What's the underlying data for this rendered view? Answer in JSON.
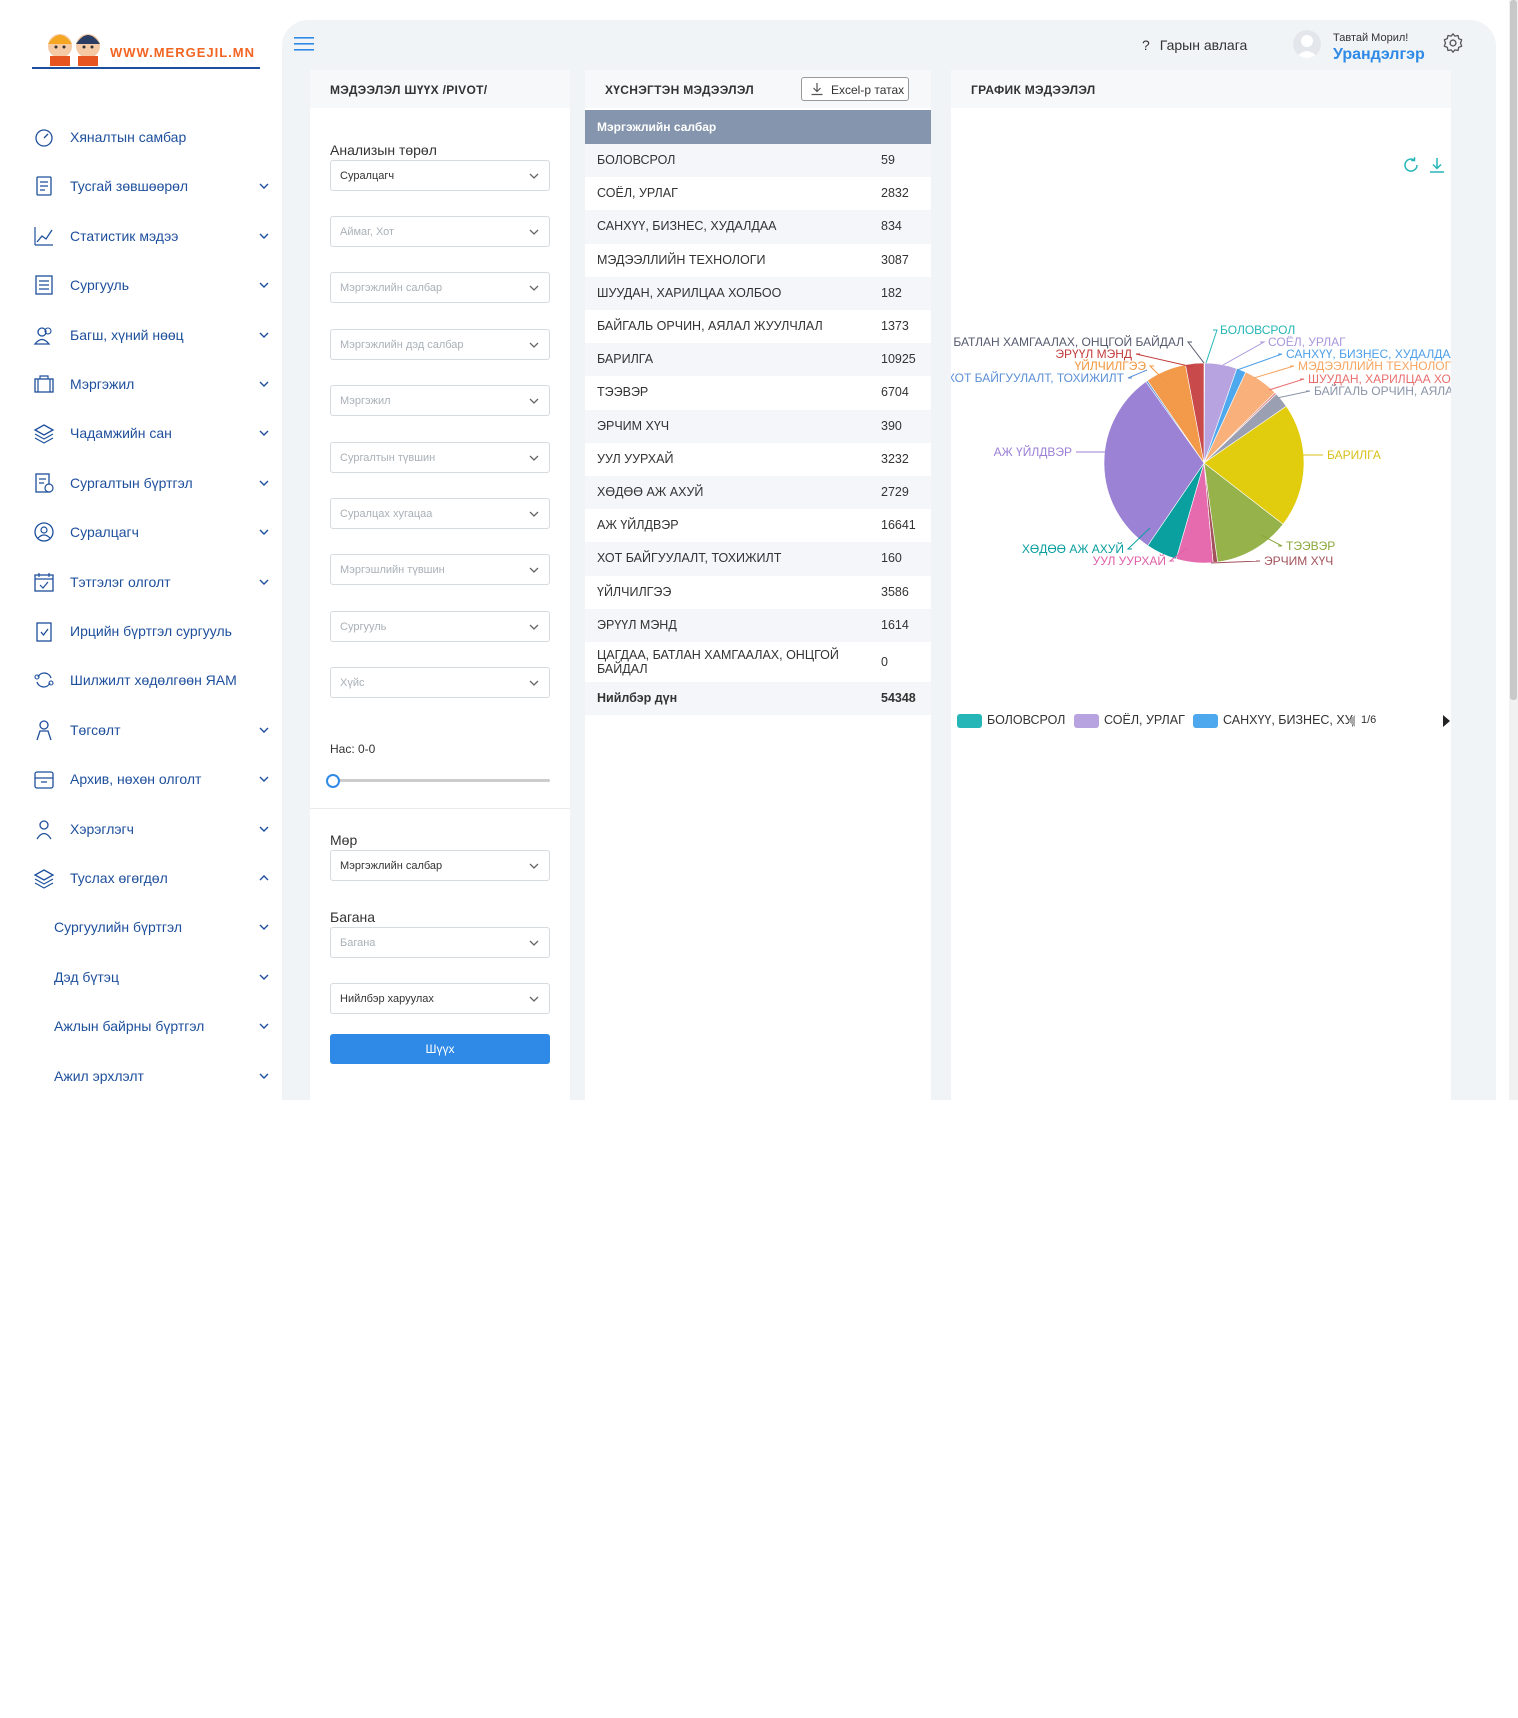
{
  "brand": {
    "site": "WWW.MERGEJIL.MN"
  },
  "sidebar": {
    "items": [
      {
        "label": "Хяналтын самбар",
        "icon": "dashboard-icon",
        "chevron": ""
      },
      {
        "label": "Тусгай зөвшөөрөл",
        "icon": "document-icon",
        "chevron": "down"
      },
      {
        "label": "Статистик мэдээ",
        "icon": "line-chart-icon",
        "chevron": "down"
      },
      {
        "label": "Сургууль",
        "icon": "list-icon",
        "chevron": "down"
      },
      {
        "label": "Багш, хүний нөөц",
        "icon": "users-icon",
        "chevron": "down"
      },
      {
        "label": "Мэргэжил",
        "icon": "briefcase-icon",
        "chevron": "down"
      },
      {
        "label": "Чадамжийн сан",
        "icon": "layers-icon",
        "chevron": "down"
      },
      {
        "label": "Сургалтын бүртгэл",
        "icon": "register-icon",
        "chevron": "down"
      },
      {
        "label": "Суралцагч",
        "icon": "student-icon",
        "chevron": "down"
      },
      {
        "label": "Тэтгэлэг олголт",
        "icon": "calendar-check-icon",
        "chevron": "down"
      },
      {
        "label": "Ирцийн бүртгэл сургууль",
        "icon": "clipboard-check-icon",
        "chevron": ""
      },
      {
        "label": "Шилжилт хөдөлгөөн ЯАМ",
        "icon": "transfer-icon",
        "chevron": ""
      },
      {
        "label": "Төгсөлт",
        "icon": "graduate-icon",
        "chevron": "down"
      },
      {
        "label": "Архив, нөхөн олголт",
        "icon": "archive-icon",
        "chevron": "down"
      },
      {
        "label": "Хэрэглэгч",
        "icon": "user-settings-icon",
        "chevron": "down"
      },
      {
        "label": "Туслах өгөгдөл",
        "icon": "stack-icon",
        "chevron": "up"
      }
    ],
    "subitems": [
      {
        "label": "Сургуулийн бүртгэл"
      },
      {
        "label": "Дэд бүтэц"
      },
      {
        "label": "Ажлын байрны бүртгэл"
      },
      {
        "label": "Ажил эрхлэлт"
      }
    ]
  },
  "topbar": {
    "help_label": "Гарын авлага",
    "welcome": "Тавтай Морил!",
    "username": "Урандэлгэр"
  },
  "filter_panel": {
    "title": "МЭДЭЭЛЭЛ ШҮҮХ /PIVOT/",
    "analysis_label": "Анализын төрөл",
    "analysis_value": "Суралцагч",
    "placeholders": [
      "Аймаг, Хот",
      "Мэргэжлийн салбар",
      "Мэргэжлийн дэд салбар",
      "Мэргэжил",
      "Сургалтын түвшин",
      "Суралцах хугацаа",
      "Мэргэшлийн түвшин",
      "Сургууль",
      "Хүйс"
    ],
    "age_label": "Нас: 0-0",
    "age_range": [
      0,
      0
    ],
    "row_label": "Мөр",
    "row_value": "Мэргэжлийн салбар",
    "column_label": "Багана",
    "column_placeholder": "Багана",
    "total_value": "Нийлбэр харуулах",
    "submit_label": "Шүүх"
  },
  "table_panel": {
    "title": "ХҮСНЭГТЭН МЭДЭЭЛЭЛ",
    "export_label": "Excel-р татах",
    "header": "Мэргэжлийн салбар",
    "rows": [
      {
        "name": "БОЛОВСРОЛ",
        "value": "59"
      },
      {
        "name": "СОЁЛ, УРЛАГ",
        "value": "2832"
      },
      {
        "name": "САНХҮҮ, БИЗНЕС, ХУДАЛДАА",
        "value": "834"
      },
      {
        "name": "МЭДЭЭЛЛИЙН ТЕХНОЛОГИ",
        "value": "3087"
      },
      {
        "name": "ШУУДАН, ХАРИЛЦАА ХОЛБОО",
        "value": "182"
      },
      {
        "name": "БАЙГАЛЬ ОРЧИН, АЯЛАЛ ЖУУЛЧЛАЛ",
        "value": "1373"
      },
      {
        "name": "БАРИЛГА",
        "value": "10925"
      },
      {
        "name": "ТЭЭВЭР",
        "value": "6704"
      },
      {
        "name": "ЭРЧИМ ХҮЧ",
        "value": "390"
      },
      {
        "name": "УУЛ УУРХАЙ",
        "value": "3232"
      },
      {
        "name": "ХӨДӨӨ АЖ АХУЙ",
        "value": "2729"
      },
      {
        "name": "АЖ ҮЙЛДВЭР",
        "value": "16641"
      },
      {
        "name": "ХОТ БАЙГУУЛАЛТ, ТОХИЖИЛТ",
        "value": "160"
      },
      {
        "name": "ҮЙЛЧИЛГЭЭ",
        "value": "3586"
      },
      {
        "name": "ЭРҮҮЛ МЭНД",
        "value": "1614"
      },
      {
        "name": "ЦАГДАА, БАТЛАН ХАМГААЛАХ, ОНЦГОЙ БАЙДАЛ",
        "value": "0"
      }
    ],
    "total": {
      "name": "Нийлбэр дүн",
      "value": "54348"
    }
  },
  "chart_panel": {
    "title": "ГРАФИК МЭДЭЭЛЭЛ",
    "legend_page": "1/6",
    "legend_visible": [
      "БОЛОВСРОЛ",
      "СОЁЛ, УРЛАГ",
      "САНХҮҮ, БИЗНЕС, ХУДАЛДАА"
    ],
    "pie_labels": [
      {
        "text": "БОЛОВСРОЛ",
        "color": "#26b6b8"
      },
      {
        "text": "СОЁЛ, УРЛАГ",
        "color": "#a896dc"
      },
      {
        "text": "САНХҮҮ, БИЗНЕС, ХУДАЛДАА",
        "color": "#4d9fe8"
      },
      {
        "text": "МЭДЭЭЛЛИЙН ТЕХНОЛОГИ",
        "color": "#f5a55f"
      },
      {
        "text": "ШУУДАН, ХАРИЛЦАА ХОЛБОО",
        "color": "#e86e6e"
      },
      {
        "text": "БАЙГАЛЬ ОРЧИН, АЯЛАЛ ЖУУЛЧЛАЛ",
        "color": "#8a94a8"
      },
      {
        "text": "БАРИЛГА",
        "color": "#d9c11a"
      },
      {
        "text": "ТЭЭВЭР",
        "color": "#8aa63a"
      },
      {
        "text": "ЭРЧИМ ХҮЧ",
        "color": "#a3525b"
      },
      {
        "text": "УУЛ УУРХАЙ",
        "color": "#e060a8"
      },
      {
        "text": "ХӨДӨӨ АЖ АХУЙ",
        "color": "#0a9e9e"
      },
      {
        "text": "АЖ ҮЙЛДВЭР",
        "color": "#9b7fd6"
      },
      {
        "text": "ХОТ БАЙГУУЛАЛТ, ТОХИЖИЛТ",
        "color": "#5b8fd6"
      },
      {
        "text": "ҮЙЛЧИЛГЭЭ",
        "color": "#f0963c"
      },
      {
        "text": "ЭРҮҮЛ МЭНД",
        "color": "#c33c3c"
      },
      {
        "text": "ЦАГДАА, БАТЛАН ХАМГААЛАХ, ОНЦГОЙ БАЙДАЛ",
        "color": "#555a6e"
      }
    ]
  },
  "chart_data": {
    "type": "pie",
    "categories": [
      "БОЛОВСРОЛ",
      "СОЁЛ, УРЛАГ",
      "САНХҮҮ, БИЗНЕС, ХУДАЛДАА",
      "МЭДЭЭЛЛИЙН ТЕХНОЛОГИ",
      "ШУУДАН, ХАРИЛЦАА ХОЛБОО",
      "БАЙГАЛЬ ОРЧИН, АЯЛАЛ ЖУУЛЧЛАЛ",
      "БАРИЛГА",
      "ТЭЭВЭР",
      "ЭРЧИМ ХҮЧ",
      "УУЛ УУРХАЙ",
      "ХӨДӨӨ АЖ АХУЙ",
      "АЖ ҮЙЛДВЭР",
      "ХОТ БАЙГУУЛАЛТ, ТОХИЖИЛТ",
      "ҮЙЛЧИЛГЭЭ",
      "ЭРҮҮЛ МЭНД",
      "ЦАГДАА, БАТЛАН ХАМГААЛАХ, ОНЦГОЙ БАЙДАЛ"
    ],
    "values": [
      59,
      2832,
      834,
      3087,
      182,
      1373,
      10925,
      6704,
      390,
      3232,
      2729,
      16641,
      160,
      3586,
      1614,
      0
    ],
    "colors": [
      "#26b6b8",
      "#b7a3e0",
      "#4da8ee",
      "#f9b07a",
      "#e88a8a",
      "#9aa0b2",
      "#e2cc0e",
      "#96b24a",
      "#a3525b",
      "#e56aae",
      "#0aa0a0",
      "#9b82d4",
      "#5b8fd6",
      "#f39a4a",
      "#c84a4a",
      "#555a6e"
    ],
    "legend": "bottom"
  }
}
